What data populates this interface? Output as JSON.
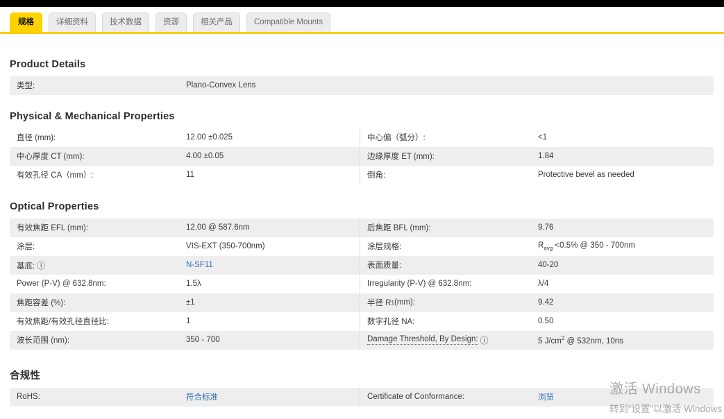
{
  "colors": {
    "accent_yellow": "#ffd200",
    "tab_inactive_bg": "#ececec",
    "row_shaded_bg": "#eeeeee",
    "link_blue": "#2f70b4",
    "top_bar": "#000000"
  },
  "icons": {
    "info": "ⓘ"
  },
  "tabs": [
    {
      "label": "规格",
      "active": true
    },
    {
      "label": "详细资料",
      "active": false
    },
    {
      "label": "技术数据",
      "active": false
    },
    {
      "label": "资源",
      "active": false
    },
    {
      "label": "相关产品",
      "active": false
    },
    {
      "label": "Compatible Mounts",
      "active": false
    }
  ],
  "sections": {
    "product": {
      "title": "Product Details",
      "rows": [
        {
          "label": "类型:",
          "value": "Plano-Convex Lens"
        }
      ]
    },
    "physical": {
      "title": "Physical & Mechanical Properties",
      "rows": [
        {
          "l_label": "直径 (mm):",
          "l_value": "12.00 ±0.025",
          "r_label": "中心偏（弧分）:",
          "r_value": "<1"
        },
        {
          "l_label": "中心厚度 CT (mm):",
          "l_value": "4.00 ±0.05",
          "r_label": "边缘厚度 ET (mm):",
          "r_value": "1.84"
        },
        {
          "l_label": "有效孔径 CA（mm）:",
          "l_value": "11",
          "r_label": "倒角:",
          "r_value": "Protective bevel as needed"
        }
      ]
    },
    "optical": {
      "title": "Optical Properties",
      "rows": [
        {
          "l_label": "有效焦距 EFL (mm):",
          "l_value": "12.00 @ 587.6nm",
          "r_label": "后焦距 BFL (mm):",
          "r_value": "9.76"
        },
        {
          "l_label": "涂层:",
          "l_value": "VIS-EXT (350-700nm)",
          "r_label": "涂层规格:",
          "r_value_parts": {
            "pre": "R",
            "sub": "avg",
            "post": " <0.5% @ 350 - 700nm"
          }
        },
        {
          "l_label": "基底:",
          "l_value": "N-SF11",
          "r_label": "表面质量:",
          "r_value": "40-20"
        },
        {
          "l_label": "Power (P-V) @ 632.8nm:",
          "l_value": "1.5λ",
          "r_label": "Irregularity (P-V) @ 632.8nm:",
          "r_value": "λ/4"
        },
        {
          "l_label": "焦距容差 (%):",
          "l_value": "±1",
          "r_label_parts": {
            "pre": "半径 R",
            "sub": "1",
            "post": " (mm):"
          },
          "r_value": "9.42"
        },
        {
          "l_label": "有效焦距/有效孔径直径比:",
          "l_value": "1",
          "r_label": "数字孔径 NA:",
          "r_value": "0.50"
        },
        {
          "l_label": "波长范围 (nm):",
          "l_value": "350 - 700",
          "r_label": "Damage Threshold, By Design:",
          "r_value_parts": {
            "pre": "5 J/cm",
            "sup": "2",
            "post": " @ 532nm, 10ns"
          }
        }
      ]
    },
    "compliance": {
      "title": "合规性",
      "rows": [
        {
          "l_label": "RoHS:",
          "l_value": "符合标准",
          "r_label": "Certificate of Conformance:",
          "r_value": "浏览"
        }
      ]
    }
  },
  "watermark": {
    "line1": "激活 Windows",
    "line2": "转到“设置”以激活 Windows"
  }
}
